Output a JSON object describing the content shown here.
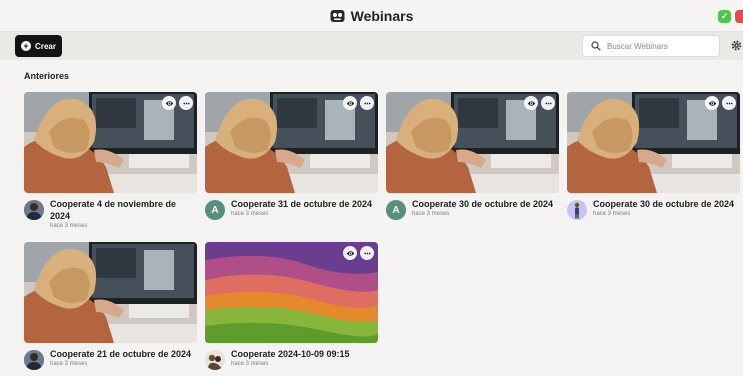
{
  "window": {
    "title": "Webinars",
    "controls": {
      "confirm_icon": "check-icon",
      "close_icon": "close-icon"
    }
  },
  "toolbar": {
    "create_label": "Crear",
    "search_placeholder": "Buscar Webinars",
    "settings_icon": "gear-icon"
  },
  "section": {
    "title": "Anteriores"
  },
  "webinars": [
    {
      "title": "Cooperate 4 de noviembre de 2024",
      "time": "hace 3 meses",
      "avatar": "photo"
    },
    {
      "title": "Cooperate 31 de octubre de 2024",
      "time": "hace 3 meses",
      "avatar": "A"
    },
    {
      "title": "Cooperate 30 de octubre de 2024",
      "time": "hace 3 meses",
      "avatar": "A"
    },
    {
      "title": "Cooperate 30 de octubre de 2024",
      "time": "hace 3 meses",
      "avatar": "illustration"
    },
    {
      "title": "Cooperate 21 de octubre de 2024",
      "time": "hace 3 meses",
      "avatar": "photo"
    },
    {
      "title": "Cooperate 2024-10-09 09:15",
      "time": "hace 3 meses",
      "avatar": "photo"
    }
  ],
  "colors": {
    "accent_dark": "#141414",
    "avatar_green": "#55907a",
    "confirm_green": "#4cc54f",
    "close_red": "#e84b4b"
  }
}
